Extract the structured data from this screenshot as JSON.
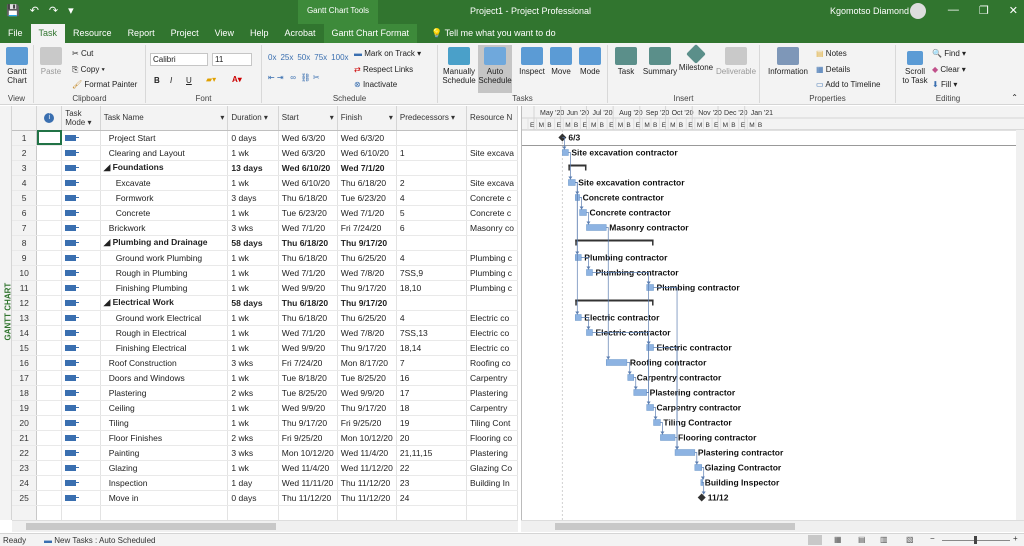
{
  "titlebar": {
    "save_icon": "save-icon",
    "undo_icon": "undo-icon",
    "redo_icon": "redo-icon",
    "customize_icon": "customize-qat-icon",
    "context_tool": "Gantt Chart Tools",
    "title": "Project1  -  Project Professional",
    "user": "Kgomotso Diamond",
    "minimize": "—",
    "restore": "❐",
    "close": "✕"
  },
  "tabs": [
    "File",
    "Task",
    "Resource",
    "Report",
    "Project",
    "View",
    "Help",
    "Acrobat",
    "Gantt Chart Format"
  ],
  "active_tab": "Task",
  "tell_me": "Tell me what you want to do",
  "ribbon": {
    "view": {
      "button": "Gantt Chart",
      "label": "View"
    },
    "clipboard": {
      "paste": "Paste",
      "cut": "Cut",
      "copy": "Copy",
      "format_painter": "Format Painter",
      "label": "Clipboard"
    },
    "font": {
      "family": "Calibri",
      "size": "11",
      "bold": "B",
      "italic": "I",
      "underline": "U",
      "label": "Font"
    },
    "schedule": {
      "mark_on_track": "Mark on Track",
      "respect_links": "Respect Links",
      "inactivate": "Inactivate",
      "label": "Schedule",
      "pct": [
        "0x",
        "25x",
        "50x",
        "75x",
        "100x"
      ]
    },
    "tasks": {
      "manually": "Manually Schedule",
      "auto": "Auto Schedule",
      "inspect": "Inspect",
      "move": "Move",
      "mode": "Mode",
      "label": "Tasks"
    },
    "insert": {
      "task": "Task",
      "summary": "Summary",
      "milestone": "Milestone",
      "deliverable": "Deliverable",
      "label": "Insert"
    },
    "properties": {
      "information": "Information",
      "notes": "Notes",
      "details": "Details",
      "add_to_timeline": "Add to Timeline",
      "label": "Properties"
    },
    "editing": {
      "scroll_to_task": "Scroll to Task",
      "find": "Find",
      "clear": "Clear",
      "fill": "Fill",
      "label": "Editing"
    }
  },
  "side_label": "GANTT CHART",
  "columns": [
    "",
    "Task Mode",
    "Task Name",
    "Duration",
    "Start",
    "Finish",
    "Predecessors",
    "Resource N"
  ],
  "rows": [
    {
      "id": "1",
      "name": "Project Start",
      "dur": "0 days",
      "start": "Wed 6/3/20",
      "finish": "Wed 6/3/20",
      "pred": "",
      "res": "",
      "level": 1,
      "summary": false
    },
    {
      "id": "2",
      "name": "Clearing and Layout",
      "dur": "1 wk",
      "start": "Wed 6/3/20",
      "finish": "Wed 6/10/20",
      "pred": "1",
      "res": "Site excava",
      "level": 1,
      "summary": false
    },
    {
      "id": "3",
      "name": "Foundations",
      "dur": "13 days",
      "start": "Wed 6/10/20",
      "finish": "Wed 7/1/20",
      "pred": "",
      "res": "",
      "level": 1,
      "summary": true
    },
    {
      "id": "4",
      "name": "Excavate",
      "dur": "1 wk",
      "start": "Wed 6/10/20",
      "finish": "Thu 6/18/20",
      "pred": "2",
      "res": "Site excava",
      "level": 2,
      "summary": false
    },
    {
      "id": "5",
      "name": "Formwork",
      "dur": "3 days",
      "start": "Thu 6/18/20",
      "finish": "Tue 6/23/20",
      "pred": "4",
      "res": "Concrete c",
      "level": 2,
      "summary": false
    },
    {
      "id": "6",
      "name": "Concrete",
      "dur": "1 wk",
      "start": "Tue 6/23/20",
      "finish": "Wed 7/1/20",
      "pred": "5",
      "res": "Concrete c",
      "level": 2,
      "summary": false
    },
    {
      "id": "7",
      "name": "Brickwork",
      "dur": "3 wks",
      "start": "Wed 7/1/20",
      "finish": "Fri 7/24/20",
      "pred": "6",
      "res": "Masonry co",
      "level": 1,
      "summary": false
    },
    {
      "id": "8",
      "name": "Plumbing and Drainage",
      "dur": "58 days",
      "start": "Thu 6/18/20",
      "finish": "Thu 9/17/20",
      "pred": "",
      "res": "",
      "level": 1,
      "summary": true
    },
    {
      "id": "9",
      "name": "Ground work Plumbing",
      "dur": "1 wk",
      "start": "Thu 6/18/20",
      "finish": "Thu 6/25/20",
      "pred": "4",
      "res": "Plumbing c",
      "level": 2,
      "summary": false
    },
    {
      "id": "10",
      "name": "Rough in Plumbing",
      "dur": "1 wk",
      "start": "Wed 7/1/20",
      "finish": "Wed 7/8/20",
      "pred": "7SS,9",
      "res": "Plumbing c",
      "level": 2,
      "summary": false
    },
    {
      "id": "11",
      "name": "Finishing Plumbing",
      "dur": "1 wk",
      "start": "Wed 9/9/20",
      "finish": "Thu 9/17/20",
      "pred": "18,10",
      "res": "Plumbing c",
      "level": 2,
      "summary": false
    },
    {
      "id": "12",
      "name": "Electrical Work",
      "dur": "58 days",
      "start": "Thu 6/18/20",
      "finish": "Thu 9/17/20",
      "pred": "",
      "res": "",
      "level": 1,
      "summary": true
    },
    {
      "id": "13",
      "name": "Ground work Electrical",
      "dur": "1 wk",
      "start": "Thu 6/18/20",
      "finish": "Thu 6/25/20",
      "pred": "4",
      "res": "Electric co",
      "level": 2,
      "summary": false
    },
    {
      "id": "14",
      "name": "Rough in Electrical",
      "dur": "1 wk",
      "start": "Wed 7/1/20",
      "finish": "Wed 7/8/20",
      "pred": "7SS,13",
      "res": "Electric co",
      "level": 2,
      "summary": false
    },
    {
      "id": "15",
      "name": "Finishing Electrical",
      "dur": "1 wk",
      "start": "Wed 9/9/20",
      "finish": "Thu 9/17/20",
      "pred": "18,14",
      "res": "Electric co",
      "level": 2,
      "summary": false
    },
    {
      "id": "16",
      "name": "Roof Construction",
      "dur": "3 wks",
      "start": "Fri 7/24/20",
      "finish": "Mon 8/17/20",
      "pred": "7",
      "res": "Roofing co",
      "level": 1,
      "summary": false
    },
    {
      "id": "17",
      "name": "Doors and Windows",
      "dur": "1 wk",
      "start": "Tue 8/18/20",
      "finish": "Tue 8/25/20",
      "pred": "16",
      "res": "Carpentry",
      "level": 1,
      "summary": false
    },
    {
      "id": "18",
      "name": "Plastering",
      "dur": "2 wks",
      "start": "Tue 8/25/20",
      "finish": "Wed 9/9/20",
      "pred": "17",
      "res": "Plastering",
      "level": 1,
      "summary": false
    },
    {
      "id": "19",
      "name": "Ceiling",
      "dur": "1 wk",
      "start": "Wed 9/9/20",
      "finish": "Thu 9/17/20",
      "pred": "18",
      "res": "Carpentry",
      "level": 1,
      "summary": false
    },
    {
      "id": "20",
      "name": "Tiling",
      "dur": "1 wk",
      "start": "Thu 9/17/20",
      "finish": "Fri 9/25/20",
      "pred": "19",
      "res": "Tiling Cont",
      "level": 1,
      "summary": false
    },
    {
      "id": "21",
      "name": "Floor Finishes",
      "dur": "2 wks",
      "start": "Fri 9/25/20",
      "finish": "Mon 10/12/20",
      "pred": "20",
      "res": "Flooring co",
      "level": 1,
      "summary": false
    },
    {
      "id": "22",
      "name": "Painting",
      "dur": "3 wks",
      "start": "Mon 10/12/20",
      "finish": "Wed 11/4/20",
      "pred": "21,11,15",
      "res": "Plastering",
      "level": 1,
      "summary": false
    },
    {
      "id": "23",
      "name": "Glazing",
      "dur": "1 wk",
      "start": "Wed 11/4/20",
      "finish": "Wed 11/12/20",
      "pred": "22",
      "res": "Glazing Co",
      "level": 1,
      "summary": false
    },
    {
      "id": "24",
      "name": "Inspection",
      "dur": "1 day",
      "start": "Wed 11/11/20",
      "finish": "Thu 11/12/20",
      "pred": "23",
      "res": "Building In",
      "level": 1,
      "summary": false
    },
    {
      "id": "25",
      "name": "Move in",
      "dur": "0 days",
      "start": "Thu 11/12/20",
      "finish": "Thu 11/12/20",
      "pred": "24",
      "res": "",
      "level": 1,
      "summary": false
    }
  ],
  "gantt": {
    "months": [
      "May '20",
      "Jun '20",
      "Jul '20",
      "Aug '20",
      "Sep '20",
      "Oct '20",
      "Nov '20",
      "Dec '20",
      "Jan '21"
    ],
    "sub_labels": [
      "E",
      "M",
      "B",
      "E",
      "M",
      "B",
      "E",
      "M",
      "B",
      "E",
      "M",
      "B",
      "E",
      "M",
      "B",
      "E",
      "M",
      "B",
      "E",
      "M",
      "B",
      "E",
      "M",
      "B",
      "E",
      "M",
      "B",
      "E"
    ],
    "bar_color": "#8db3e2",
    "bars": [
      {
        "row": 0,
        "type": "milestone",
        "start": "2020-06-03",
        "label": "6/3"
      },
      {
        "row": 1,
        "type": "task",
        "start": "2020-06-03",
        "end": "2020-06-10",
        "label": "Site excavation contractor"
      },
      {
        "row": 2,
        "type": "summary",
        "start": "2020-06-10",
        "end": "2020-07-01",
        "label": ""
      },
      {
        "row": 3,
        "type": "task",
        "start": "2020-06-10",
        "end": "2020-06-18",
        "label": "Site excavation contractor"
      },
      {
        "row": 4,
        "type": "task",
        "start": "2020-06-18",
        "end": "2020-06-23",
        "label": "Concrete contractor"
      },
      {
        "row": 5,
        "type": "task",
        "start": "2020-06-23",
        "end": "2020-07-01",
        "label": "Concrete contractor"
      },
      {
        "row": 6,
        "type": "task",
        "start": "2020-07-01",
        "end": "2020-07-24",
        "label": "Masonry contractor"
      },
      {
        "row": 7,
        "type": "summary",
        "start": "2020-06-18",
        "end": "2020-09-17",
        "label": ""
      },
      {
        "row": 8,
        "type": "task",
        "start": "2020-06-18",
        "end": "2020-06-25",
        "label": "Plumbing contractor"
      },
      {
        "row": 9,
        "type": "task",
        "start": "2020-07-01",
        "end": "2020-07-08",
        "label": "Plumbing contractor"
      },
      {
        "row": 10,
        "type": "task",
        "start": "2020-09-09",
        "end": "2020-09-17",
        "label": "Plumbing contractor"
      },
      {
        "row": 11,
        "type": "summary",
        "start": "2020-06-18",
        "end": "2020-09-17",
        "label": ""
      },
      {
        "row": 12,
        "type": "task",
        "start": "2020-06-18",
        "end": "2020-06-25",
        "label": "Electric contractor"
      },
      {
        "row": 13,
        "type": "task",
        "start": "2020-07-01",
        "end": "2020-07-08",
        "label": "Electric contractor"
      },
      {
        "row": 14,
        "type": "task",
        "start": "2020-09-09",
        "end": "2020-09-17",
        "label": "Electric contractor"
      },
      {
        "row": 15,
        "type": "task",
        "start": "2020-07-24",
        "end": "2020-08-17",
        "label": "Roofing contractor"
      },
      {
        "row": 16,
        "type": "task",
        "start": "2020-08-18",
        "end": "2020-08-25",
        "label": "Carpentry contractor"
      },
      {
        "row": 17,
        "type": "task",
        "start": "2020-08-25",
        "end": "2020-09-09",
        "label": "Plastering contractor"
      },
      {
        "row": 18,
        "type": "task",
        "start": "2020-09-09",
        "end": "2020-09-17",
        "label": "Carpentry contractor"
      },
      {
        "row": 19,
        "type": "task",
        "start": "2020-09-17",
        "end": "2020-09-25",
        "label": "Tiling Contractor"
      },
      {
        "row": 20,
        "type": "task",
        "start": "2020-09-25",
        "end": "2020-10-12",
        "label": "Flooring contractor"
      },
      {
        "row": 21,
        "type": "task",
        "start": "2020-10-12",
        "end": "2020-11-04",
        "label": "Plastering contractor"
      },
      {
        "row": 22,
        "type": "task",
        "start": "2020-11-04",
        "end": "2020-11-12",
        "label": "Glazing Contractor"
      },
      {
        "row": 23,
        "type": "task",
        "start": "2020-11-11",
        "end": "2020-11-12",
        "label": "Building Inspector"
      },
      {
        "row": 24,
        "type": "milestone",
        "start": "2020-11-12",
        "label": "11/12"
      }
    ]
  },
  "status": {
    "ready": "Ready",
    "new_tasks": "New Tasks : Auto Scheduled"
  }
}
